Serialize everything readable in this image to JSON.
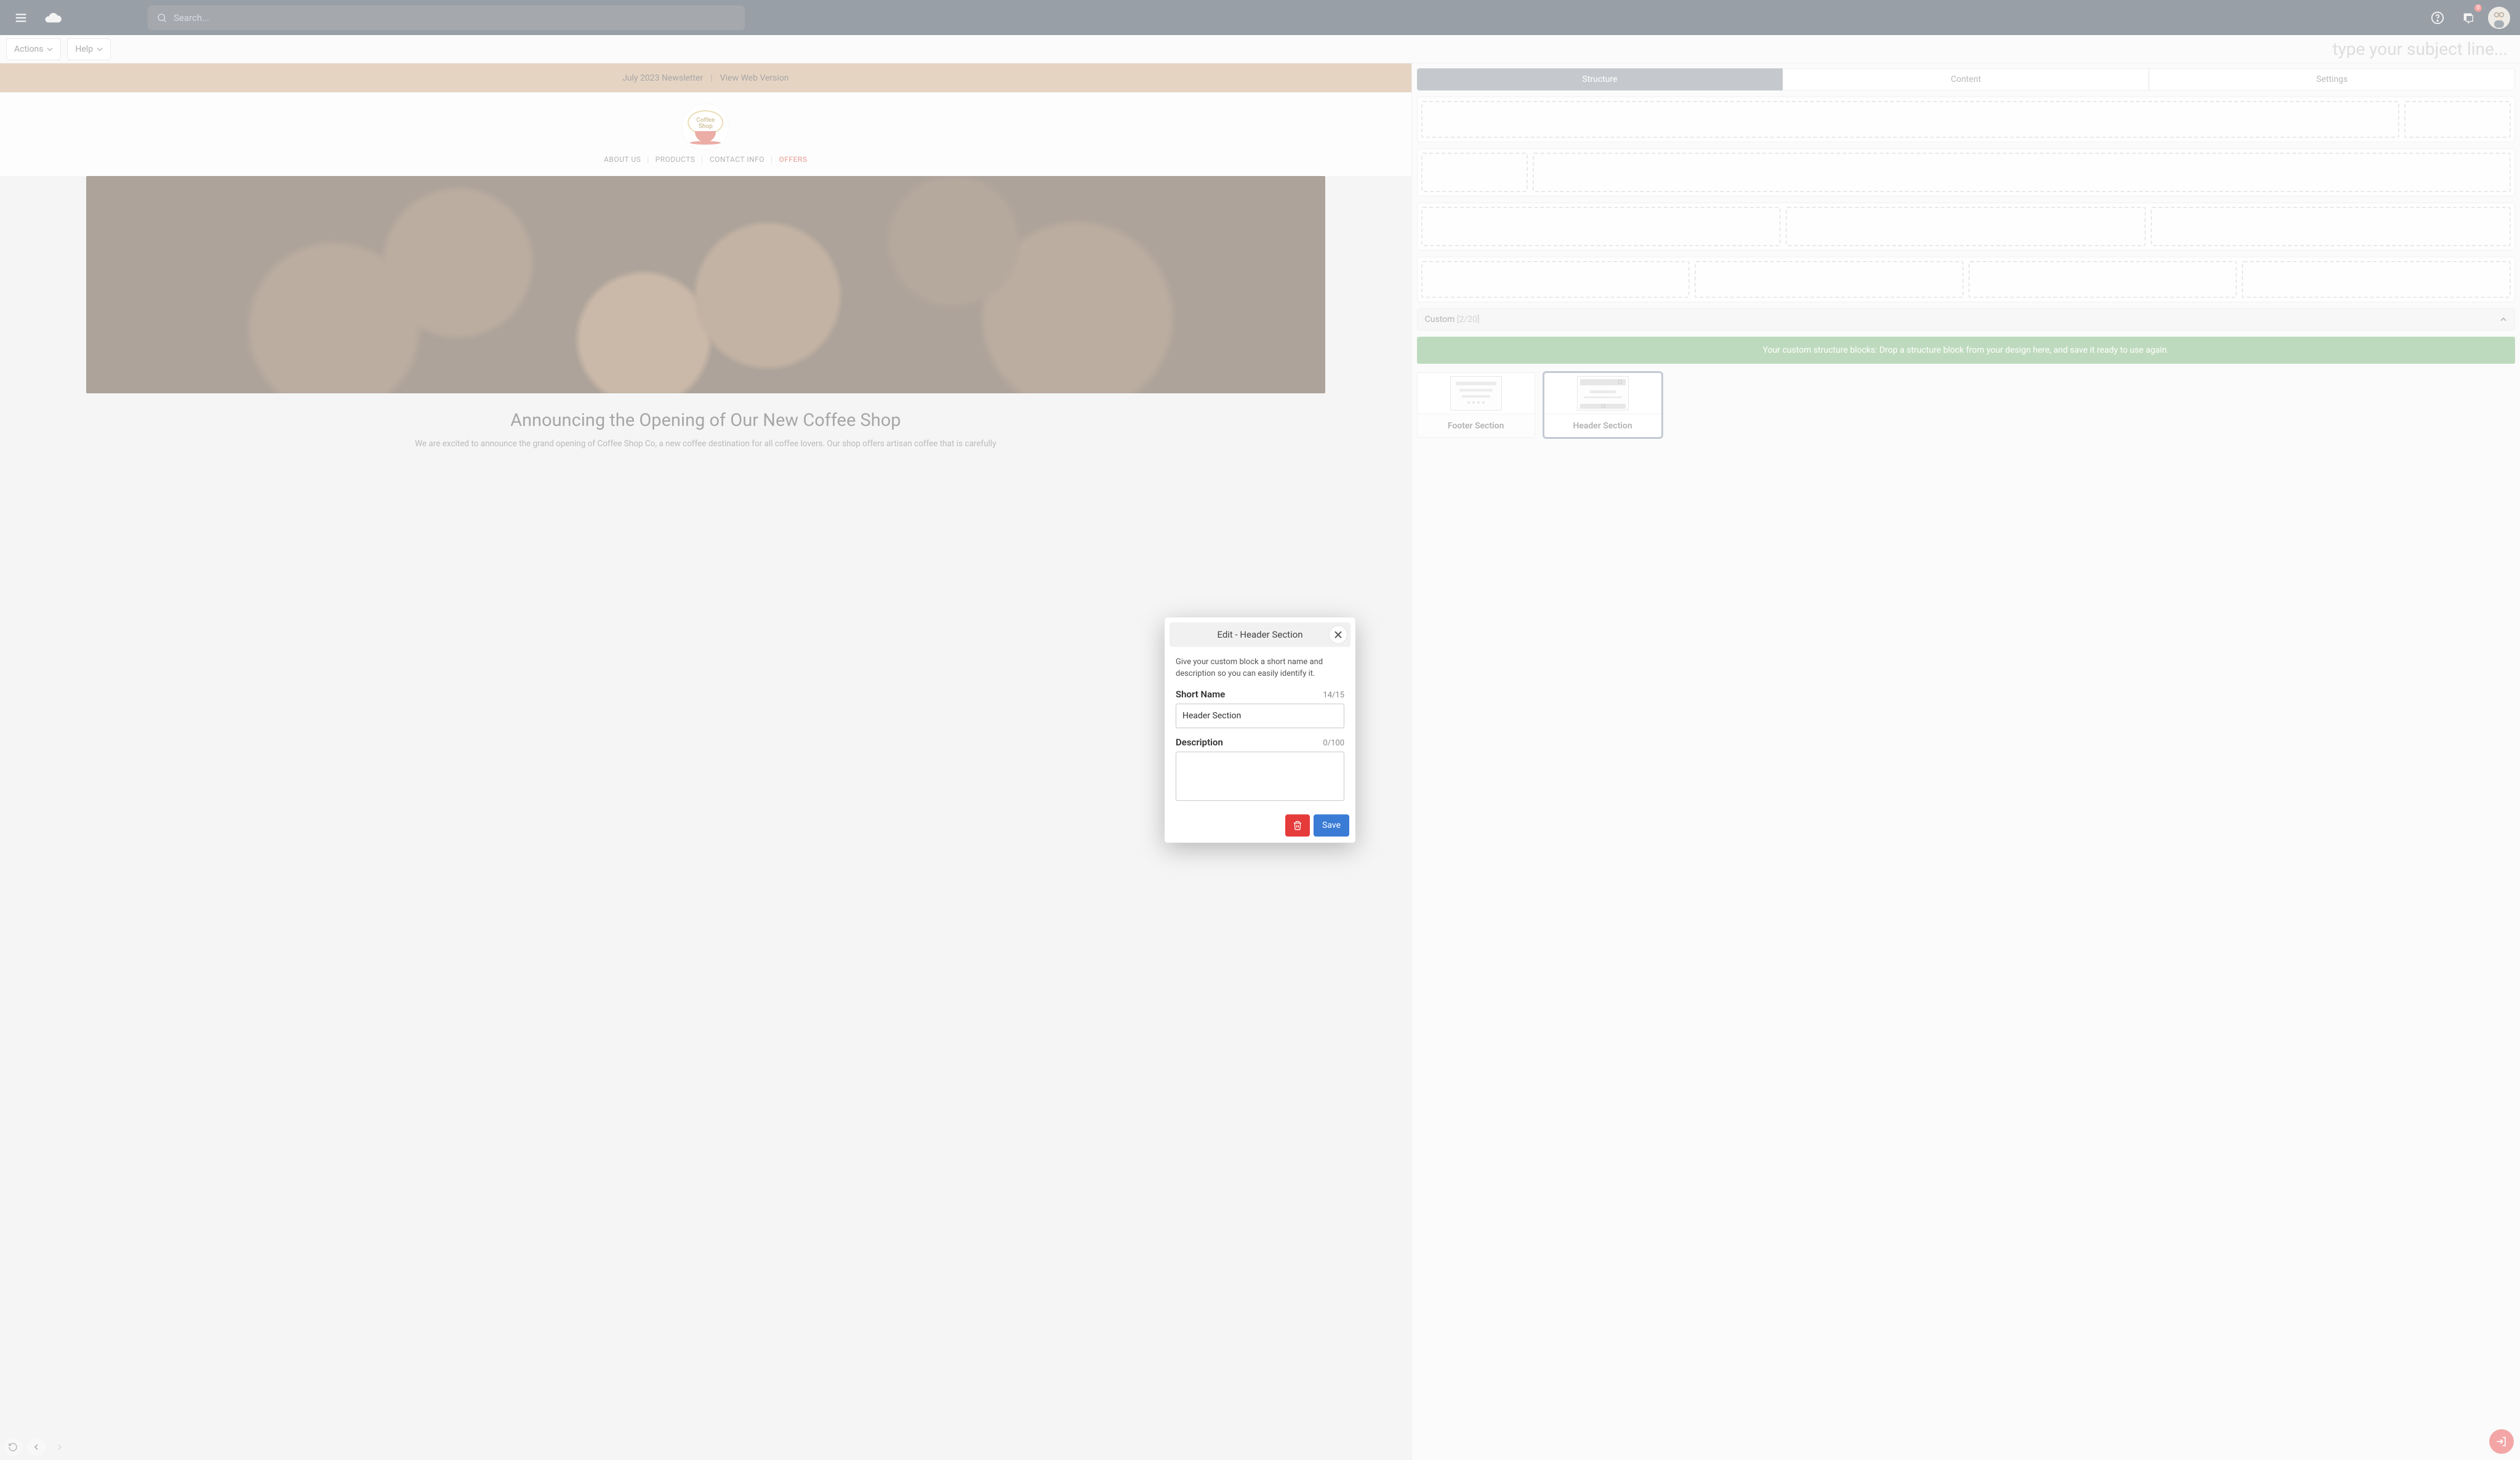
{
  "topbar": {
    "search_placeholder": "Search...",
    "badge_count": "0"
  },
  "secondbar": {
    "actions_label": "Actions",
    "help_label": "Help",
    "subject_placeholder": "type your subject line..."
  },
  "preview": {
    "newsletter_label": "July 2023 Newsletter",
    "view_web_label": "View Web Version",
    "logo_text_top": "Coffee",
    "logo_text_bottom": "Shop",
    "nav": {
      "about": "ABOUT US",
      "products": "PRODUCTS",
      "contact": "CONTACT INFO",
      "offers": "OFFERS"
    },
    "headline": "Announcing the Opening of Our New Coffee Shop",
    "body": "We are excited to announce the grand opening of Coffee Shop Co, a new coffee destination for all coffee lovers. Our shop offers artisan coffee that is carefully"
  },
  "side": {
    "tabs": {
      "structure": "Structure",
      "content": "Content",
      "settings": "Settings"
    },
    "custom_label": "Custom",
    "custom_count": "[2/20]",
    "hint": "Your custom structure blocks: Drop a structure block from your design here, and save it ready to use again.",
    "blocks": {
      "footer": "Footer Section",
      "header": "Header Section"
    }
  },
  "modal": {
    "title": "Edit - Header Section",
    "description": "Give your custom block a short name and description so you can easily identify it.",
    "short_name_label": "Short Name",
    "short_name_count": "14/15",
    "short_name_value": "Header Section",
    "desc_label": "Description",
    "desc_count": "0/100",
    "desc_value": "",
    "save_label": "Save"
  }
}
